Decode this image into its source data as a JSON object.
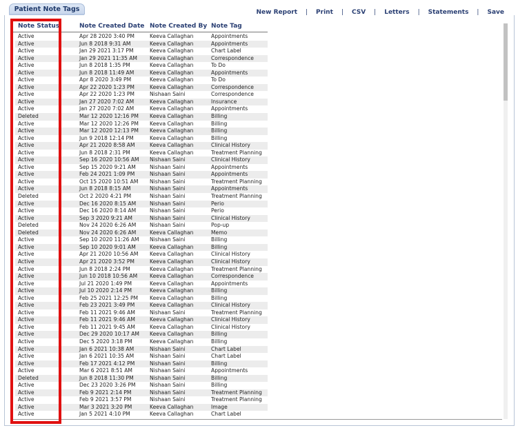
{
  "tab": {
    "label": "Patient Note Tags"
  },
  "toolbar": {
    "new_report": "New Report",
    "print": "Print",
    "csv": "CSV",
    "letters": "Letters",
    "statements": "Statements",
    "save": "Save",
    "separator": "|"
  },
  "table": {
    "headers": [
      "Note Status",
      "Note Created Date",
      "Note Created By",
      "Note Tag"
    ],
    "rows": [
      [
        "Active",
        "Apr 28 2020 3:40 PM",
        "Keeva Callaghan",
        "Appointments"
      ],
      [
        "Active",
        "Jun 8 2018 9:31 AM",
        "Keeva Callaghan",
        "Appointments"
      ],
      [
        "Active",
        "Jan 29 2021 3:17 PM",
        "Keeva Callaghan",
        "Chart Label"
      ],
      [
        "Active",
        "Jan 29 2021 11:35 AM",
        "Keeva Callaghan",
        "Correspondence"
      ],
      [
        "Active",
        "Jun 8 2018 1:35 PM",
        "Keeva Callaghan",
        "To Do"
      ],
      [
        "Active",
        "Jun 8 2018 11:49 AM",
        "Keeva Callaghan",
        "Appointments"
      ],
      [
        "Active",
        "Apr 8 2020 3:49 PM",
        "Keeva Callaghan",
        "To Do"
      ],
      [
        "Active",
        "Apr 22 2020 1:23 PM",
        "Keeva Callaghan",
        "Correspondence"
      ],
      [
        "Active",
        "Apr 22 2020 1:23 PM",
        "Nishaan Saini",
        "Correspondence"
      ],
      [
        "Active",
        "Jan 27 2020 7:02 AM",
        "Keeva Callaghan",
        "Insurance"
      ],
      [
        "Active",
        "Jan 27 2020 7:02 AM",
        "Keeva Callaghan",
        "Appointments"
      ],
      [
        "Deleted",
        "Mar 12 2020 12:16 PM",
        "Keeva Callaghan",
        "Billing"
      ],
      [
        "Active",
        "Mar 12 2020 12:26 PM",
        "Keeva Callaghan",
        "Billing"
      ],
      [
        "Active",
        "Mar 12 2020 12:13 PM",
        "Keeva Callaghan",
        "Billing"
      ],
      [
        "Active",
        "Jun 9 2018 12:14 PM",
        "Keeva Callaghan",
        "Billing"
      ],
      [
        "Active",
        "Apr 21 2020 8:58 AM",
        "Keeva Callaghan",
        "Clinical History"
      ],
      [
        "Active",
        "Jun 8 2018 2:31 PM",
        "Keeva Callaghan",
        "Treatment Planning"
      ],
      [
        "Active",
        "Sep 16 2020 10:56 AM",
        "Nishaan Saini",
        "Clinical History"
      ],
      [
        "Active",
        "Sep 15 2020 9:21 AM",
        "Nishaan Saini",
        "Appointments"
      ],
      [
        "Active",
        "Feb 24 2021 1:09 PM",
        "Nishaan Saini",
        "Appointments"
      ],
      [
        "Active",
        "Oct 15 2020 10:51 AM",
        "Nishaan Saini",
        "Treatment Planning"
      ],
      [
        "Active",
        "Jun 8 2018 8:15 AM",
        "Nishaan Saini",
        "Appointments"
      ],
      [
        "Deleted",
        "Oct 2 2020 4:21 PM",
        "Nishaan Saini",
        "Treatment Planning"
      ],
      [
        "Active",
        "Dec 16 2020 8:15 AM",
        "Nishaan Saini",
        "Perio"
      ],
      [
        "Active",
        "Dec 16 2020 8:14 AM",
        "Nishaan Saini",
        "Perio"
      ],
      [
        "Active",
        "Sep 3 2020 9:21 AM",
        "Nishaan Saini",
        "Clinical History"
      ],
      [
        "Deleted",
        "Nov 24 2020 6:26 AM",
        "Nishaan Saini",
        "Pop-up"
      ],
      [
        "Deleted",
        "Nov 24 2020 6:26 AM",
        "Keeva Callaghan",
        "Memo"
      ],
      [
        "Active",
        "Sep 10 2020 11:26 AM",
        "Nishaan Saini",
        "Billing"
      ],
      [
        "Active",
        "Sep 10 2020 9:01 AM",
        "Keeva Callaghan",
        "Billing"
      ],
      [
        "Active",
        "Apr 21 2020 10:56 AM",
        "Keeva Callaghan",
        "Clinical History"
      ],
      [
        "Active",
        "Apr 21 2020 3:52 PM",
        "Keeva Callaghan",
        "Clinical History"
      ],
      [
        "Active",
        "Jun 8 2018 2:24 PM",
        "Keeva Callaghan",
        "Treatment Planning"
      ],
      [
        "Active",
        "Jun 10 2018 10:56 AM",
        "Keeva Callaghan",
        "Correspondence"
      ],
      [
        "Active",
        "Jul 21 2020 1:49 PM",
        "Keeva Callaghan",
        "Appointments"
      ],
      [
        "Active",
        "Jul 10 2020 2:14 PM",
        "Keeva Callaghan",
        "Billing"
      ],
      [
        "Active",
        "Feb 25 2021 12:25 PM",
        "Keeva Callaghan",
        "Billing"
      ],
      [
        "Active",
        "Feb 23 2021 3:49 PM",
        "Keeva Callaghan",
        "Clinical History"
      ],
      [
        "Active",
        "Feb 11 2021 9:46 AM",
        "Nishaan Saini",
        "Treatment Planning"
      ],
      [
        "Active",
        "Feb 11 2021 9:46 AM",
        "Keeva Callaghan",
        "Clinical History"
      ],
      [
        "Active",
        "Feb 11 2021 9:45 AM",
        "Keeva Callaghan",
        "Clinical History"
      ],
      [
        "Active",
        "Dec 29 2020 10:17 AM",
        "Keeva Callaghan",
        "Billing"
      ],
      [
        "Active",
        "Dec 5 2020 3:18 PM",
        "Keeva Callaghan",
        "Billing"
      ],
      [
        "Active",
        "Jan 6 2021 10:38 AM",
        "Nishaan Saini",
        "Chart Label"
      ],
      [
        "Active",
        "Jan 6 2021 10:35 AM",
        "Nishaan Saini",
        "Chart Label"
      ],
      [
        "Active",
        "Feb 17 2021 4:12 PM",
        "Nishaan Saini",
        "Billing"
      ],
      [
        "Active",
        "Mar 6 2021 8:51 AM",
        "Nishaan Saini",
        "Appointments"
      ],
      [
        "Deleted",
        "Jun 8 2018 11:30 PM",
        "Nishaan Saini",
        "Billing"
      ],
      [
        "Active",
        "Dec 23 2020 3:26 PM",
        "Nishaan Saini",
        "Billing"
      ],
      [
        "Active",
        "Feb 9 2021 2:14 PM",
        "Nishaan Saini",
        "Treatment Planning"
      ],
      [
        "Active",
        "Feb 9 2021 3:57 PM",
        "Nishaan Saini",
        "Treatment Planning"
      ],
      [
        "Active",
        "Mar 3 2021 3:20 PM",
        "Keeva Callaghan",
        "Image"
      ],
      [
        "Active",
        "Jan 5 2021 4:10 PM",
        "Keeva Callaghan",
        "Chart Label"
      ]
    ]
  },
  "colors": {
    "highlight": "#e01010",
    "header_text": "#2a3f73",
    "row_alt": "#ececec"
  }
}
